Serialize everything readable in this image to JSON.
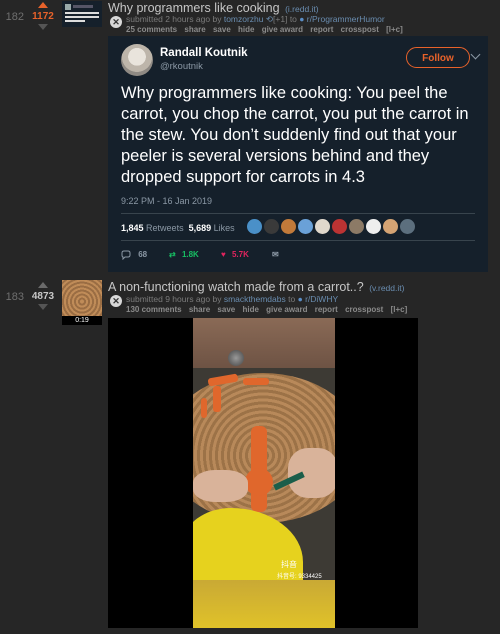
{
  "posts": [
    {
      "rank": "182",
      "score": "1172",
      "title": "Why programmers like cooking",
      "domain": "(i.redd.it)",
      "submitted": "submitted 2 hours ago by",
      "author": "tomzorzhu",
      "flair": "[+1]",
      "to": "to",
      "subreddit": "r/ProgrammerHumor",
      "comments": "25 comments",
      "share": "share",
      "save": "save",
      "hide": "hide",
      "give_award": "give award",
      "report": "report",
      "crosspost": "crosspost",
      "extra": "[l+c]"
    },
    {
      "rank": "183",
      "score": "4873",
      "title": "A non-functioning watch made from a carrot..?",
      "domain": "(v.redd.it)",
      "submitted": "submitted 9 hours ago by",
      "author": "smackthemdabs",
      "to": "to",
      "subreddit": "r/DiWHY",
      "comments": "130 comments",
      "share": "share",
      "save": "save",
      "hide": "hide",
      "give_award": "give award",
      "report": "report",
      "crosspost": "crosspost",
      "extra": "[l+c]",
      "thumb_duration": "0:19"
    }
  ],
  "tweet": {
    "name": "Randall Koutnik",
    "handle": "@rkoutnik",
    "follow_label": "Follow",
    "text": "Why programmers like cooking:  You peel the carrot, you chop the carrot, you put the carrot in the stew.  You don’t suddenly find out that your peeler is several versions behind and they dropped support for carrots in 4.3",
    "time": "9:22 PM - 16 Jan 2019",
    "retweets": "1,845",
    "retweets_label": "Retweets",
    "likes": "5,689",
    "likes_label": "Likes",
    "reply_count": "68",
    "rt_count": "1.8K",
    "like_count": "5.7K"
  },
  "video": {
    "app_logo": "抖音",
    "watermark_id": "抖音号: 9334425"
  },
  "colors": {
    "upvoted": "#e8622a",
    "score_default": "#c8c8c8",
    "twitter_bg": "#15202b",
    "like": "#e0245e",
    "retweet": "#17bf63"
  }
}
